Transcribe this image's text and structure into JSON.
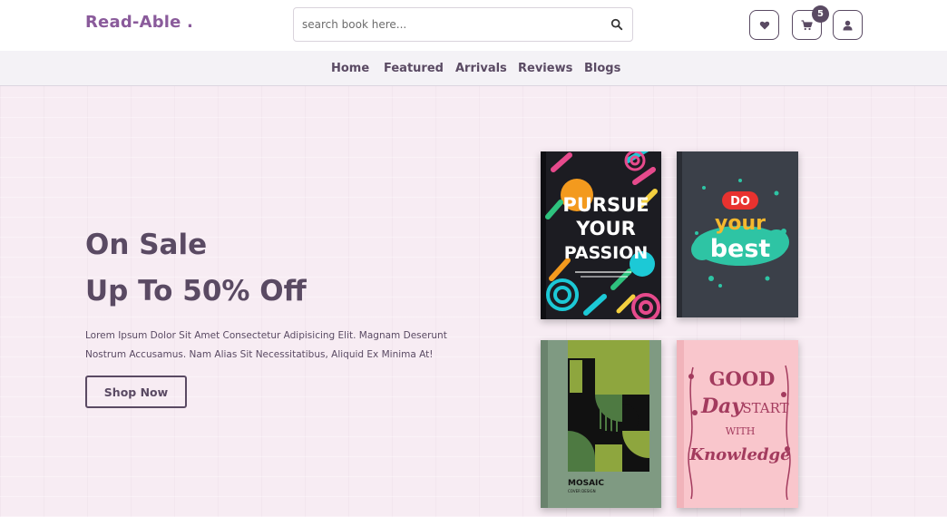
{
  "header": {
    "logo": "Read-Able .",
    "search": {
      "placeholder": "search book here..."
    },
    "cart_count": "5"
  },
  "nav": {
    "items": [
      "Home",
      "Featured",
      "Arrivals",
      "Reviews",
      "Blogs"
    ]
  },
  "hero": {
    "line1": "On Sale",
    "line2": "Up To 50% Off",
    "description": "Lorem Ipsum Dolor Sit Amet Consectetur Adipisicing Elit. Magnam Deserunt Nostrum Accusamus. Nam Alias Sit Necessitatibus, Aliquid Ex Minima At!",
    "button": "Shop Now"
  },
  "books": {
    "book1": {
      "lines": [
        "PURSUE",
        "YOUR",
        "PASSION"
      ]
    },
    "book2": {
      "lines": [
        "DO",
        "your",
        "best"
      ]
    },
    "book3": {
      "title": "MOSAIC",
      "subtitle": "COVER DESIGN"
    },
    "book4": {
      "lines": [
        "GOOD",
        "Day",
        "START",
        "WITH",
        "Knowledge"
      ]
    }
  },
  "colors": {
    "brand": "#8a5b9b",
    "primary": "#5a4a63",
    "hero_bg": "#f7ecf3",
    "nav_bg": "#f4f2f6"
  },
  "icons": {
    "search": "search-icon",
    "wishlist": "heart-icon",
    "cart": "cart-icon",
    "account": "user-icon"
  }
}
